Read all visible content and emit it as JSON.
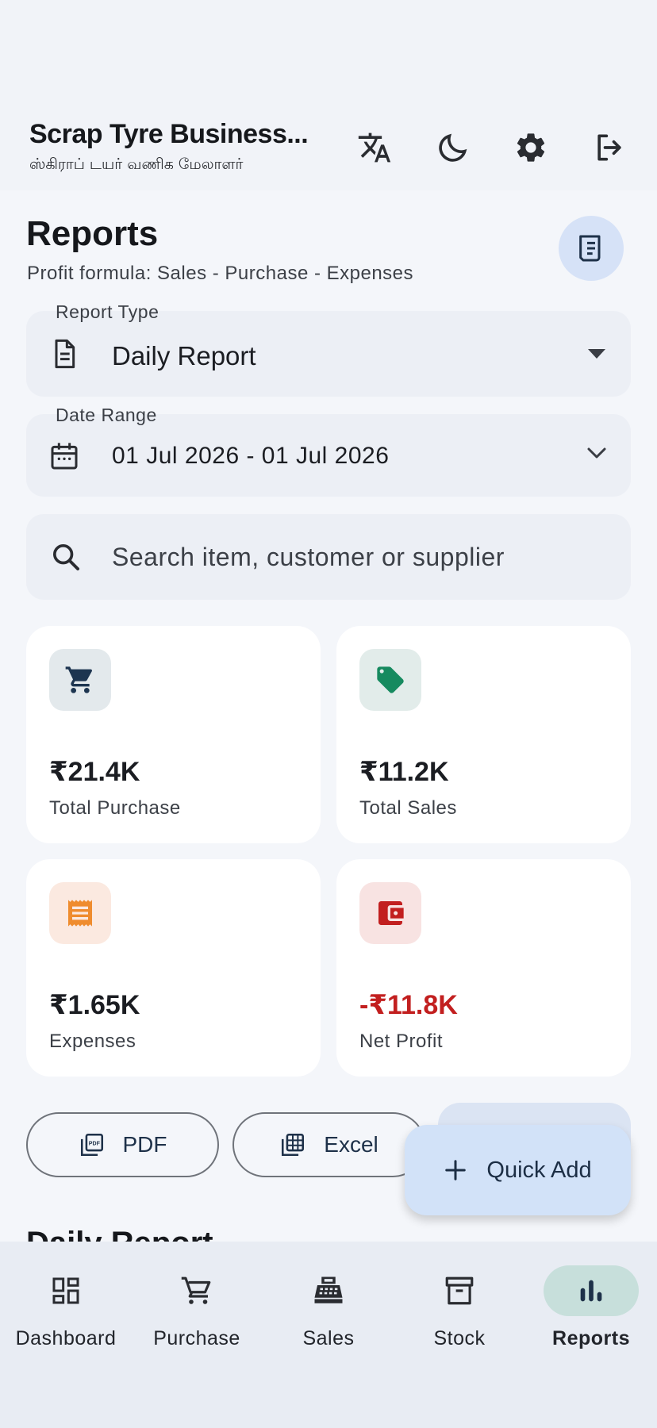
{
  "app": {
    "title": "Scrap Tyre Business...",
    "subtitle": "ஸ்கிராப் டயர் வணிக மேலாளர்"
  },
  "appbar_icons": [
    "translate-icon",
    "dark-mode-icon",
    "settings-icon",
    "logout-icon"
  ],
  "page": {
    "title": "Reports",
    "subtitle": "Profit formula: Sales - Purchase - Expenses"
  },
  "report_type": {
    "label": "Report Type",
    "value": "Daily Report"
  },
  "date_range": {
    "label": "Date Range",
    "value": "01 Jul 2026 - 01 Jul 2026"
  },
  "search": {
    "placeholder": "Search item, customer or supplier"
  },
  "cards": [
    {
      "amount": "₹21.4K",
      "label": "Total Purchase",
      "icon": "cart-icon",
      "color": "#1d3550",
      "bg": "#e3e9ec"
    },
    {
      "amount": "₹11.2K",
      "label": "Total Sales",
      "icon": "tag-icon",
      "color": "#168a5f",
      "bg": "#e2ecea"
    },
    {
      "amount": "₹1.65K",
      "label": "Expenses",
      "icon": "receipt-icon",
      "color": "#ef8c2e",
      "bg": "#fbe9e0"
    },
    {
      "amount": "-₹11.8K",
      "label": "Net Profit",
      "icon": "wallet-icon",
      "color": "#c21f1f",
      "amount_color": "#c21f1f",
      "bg": "#f8e3e2"
    }
  ],
  "export": {
    "pdf": "PDF",
    "excel": "Excel"
  },
  "fab": {
    "label": "Quick Add"
  },
  "section": {
    "title": "Daily Report"
  },
  "nav": [
    {
      "label": "Dashboard",
      "icon": "dashboard-icon",
      "active": false
    },
    {
      "label": "Purchase",
      "icon": "cart-icon",
      "active": false
    },
    {
      "label": "Sales",
      "icon": "register-icon",
      "active": false
    },
    {
      "label": "Stock",
      "icon": "archive-icon",
      "active": false
    },
    {
      "label": "Reports",
      "icon": "bar-chart-icon",
      "active": true
    }
  ],
  "colors": {
    "background": "#f4f6fa",
    "accent_blue": "#d2e2f8",
    "active_nav": "#c7dfdb",
    "negative": "#c21f1f"
  }
}
